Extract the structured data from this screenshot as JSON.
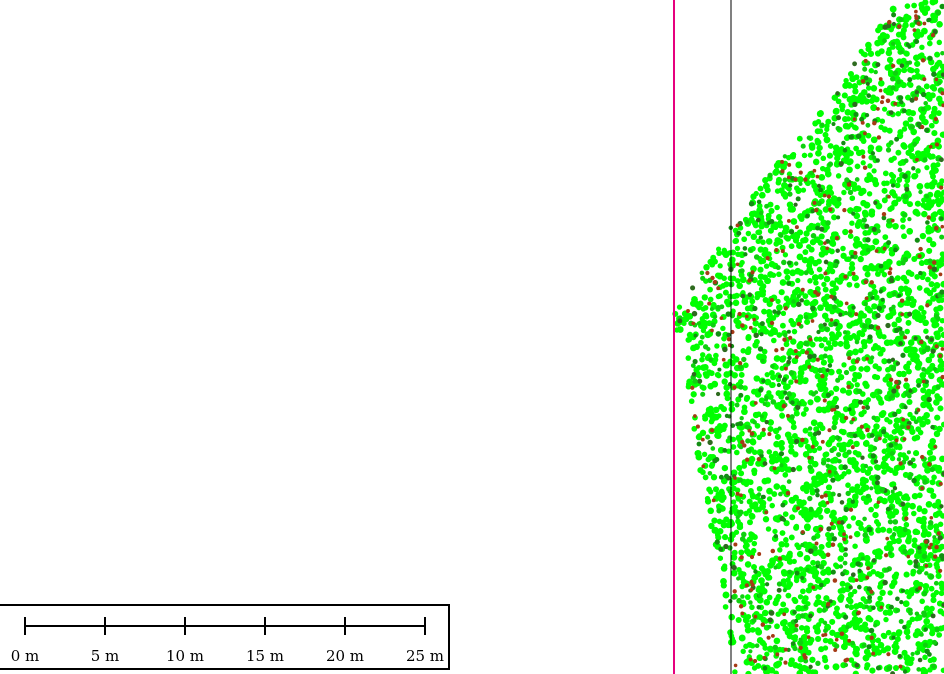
{
  "map": {
    "background": "#ffffff",
    "boundary_line_color": "#e6007e",
    "reference_line_color": "#000000",
    "point_colors": {
      "vegetation_light": "#00ff00",
      "vegetation_mid": "#0fd00f",
      "vegetation_dark": "#138e13",
      "vegetation_deep": "#2e6b1f",
      "feature_red": "#a53a16"
    }
  },
  "scalebar": {
    "unit": "m",
    "labels": [
      "0 m",
      "5 m",
      "10 m",
      "15 m",
      "20 m",
      "25 m"
    ]
  }
}
